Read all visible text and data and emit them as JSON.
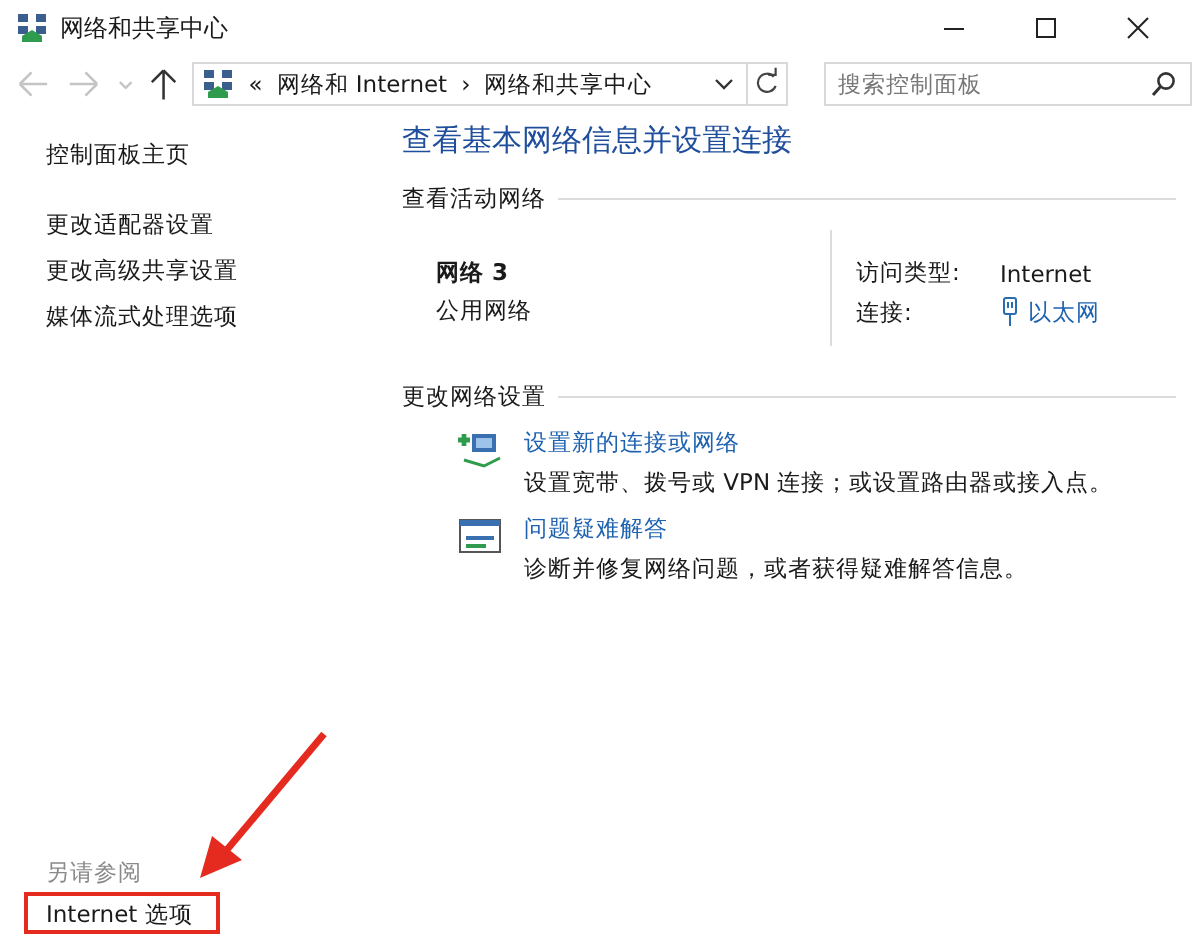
{
  "window": {
    "title": "网络和共享中心"
  },
  "nav": {
    "buttons": [
      {
        "kind": "back",
        "disabled": true
      },
      {
        "kind": "forward",
        "disabled": true
      },
      {
        "kind": "recent",
        "disabled": true
      },
      {
        "kind": "up",
        "disabled": false
      }
    ],
    "overflow": "«",
    "separator": "›",
    "breadcrumb": [
      "网络和 Internet",
      "网络和共享中心"
    ],
    "search": {
      "placeholder": "搜索控制面板"
    }
  },
  "sidebar": {
    "items": [
      "控制面板主页",
      "更改适配器设置",
      "更改高级共享设置",
      "媒体流式处理选项"
    ],
    "see_also": {
      "heading": "另请参阅",
      "items": [
        "Internet 选项"
      ]
    }
  },
  "content": {
    "heading": "查看基本网络信息并设置连接",
    "active_section": {
      "title": "查看活动网络",
      "network_name": "网络 3",
      "network_category": "公用网络",
      "rows": [
        {
          "label": "访问类型:",
          "value": "Internet",
          "kind": "text"
        },
        {
          "label": "连接:",
          "value": "以太网",
          "kind": "link"
        }
      ]
    },
    "change_section": {
      "title": "更改网络设置",
      "tasks": [
        {
          "kind": "new-connection",
          "link": "设置新的连接或网络",
          "description": "设置宽带、拨号或 VPN 连接；或设置路由器或接入点。"
        },
        {
          "kind": "troubleshoot",
          "link": "问题疑难解答",
          "description": "诊断并修复网络问题，或者获得疑难解答信息。"
        }
      ]
    }
  }
}
